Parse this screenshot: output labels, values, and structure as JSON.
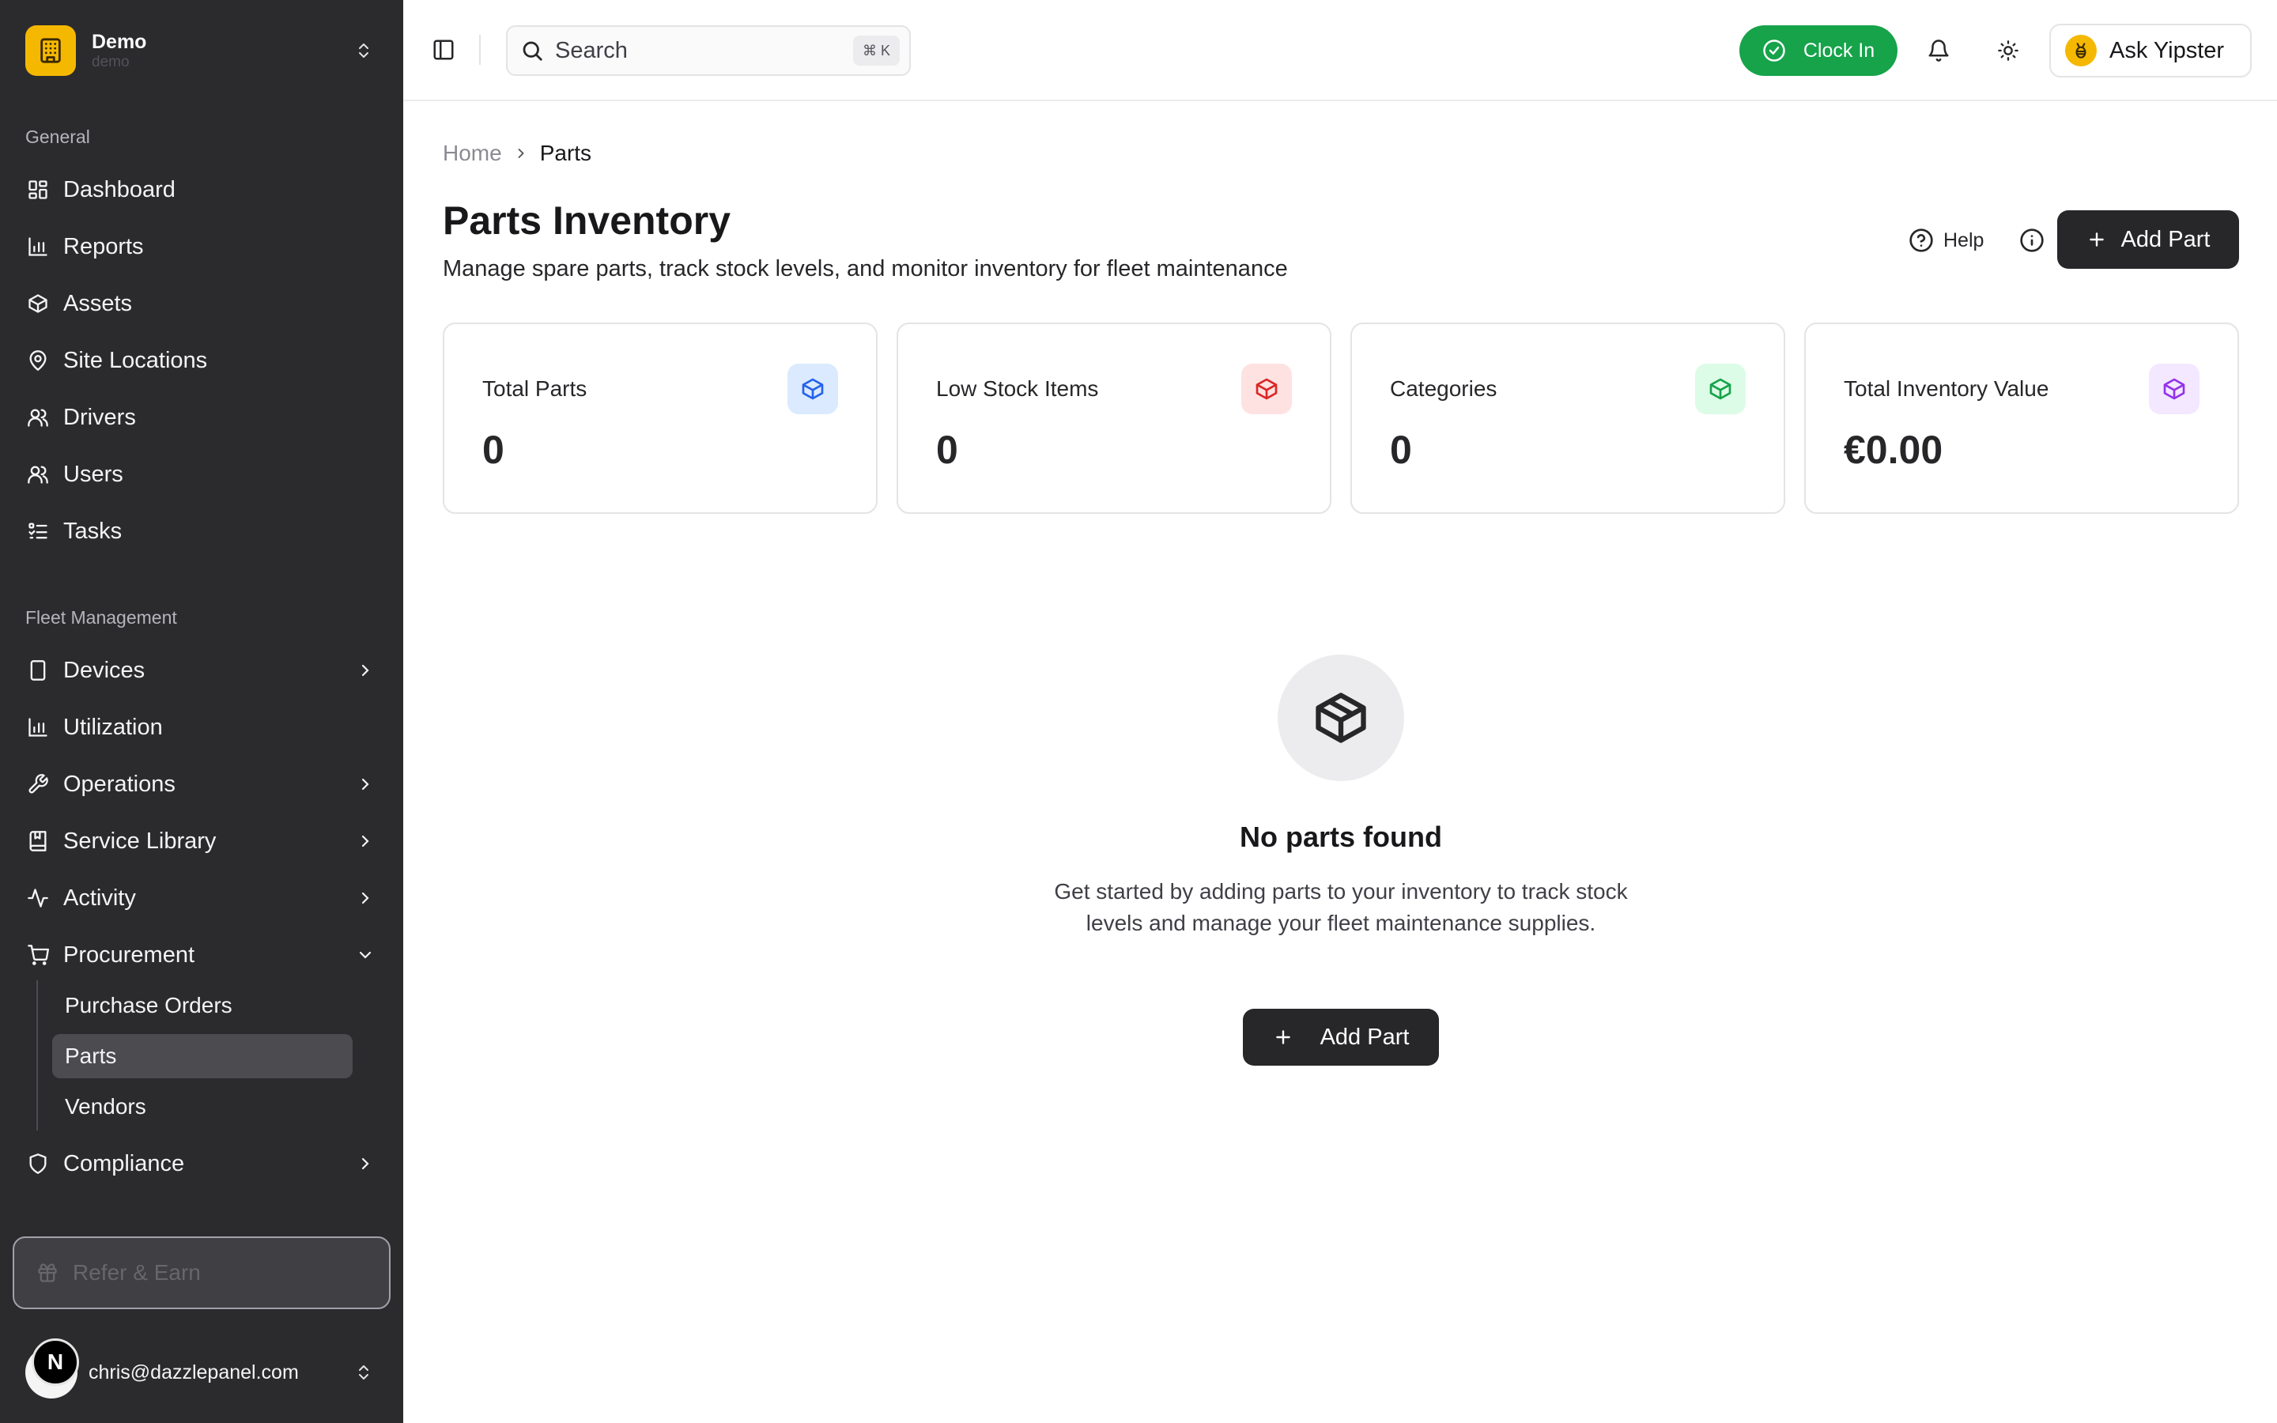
{
  "workspace": {
    "name": "Demo",
    "subtitle": "demo"
  },
  "sidebar": {
    "general_label": "General",
    "general_items": [
      {
        "label": "Dashboard",
        "icon": "dashboard-icon"
      },
      {
        "label": "Reports",
        "icon": "bar-chart-icon"
      },
      {
        "label": "Assets",
        "icon": "box-icon"
      },
      {
        "label": "Site Locations",
        "icon": "map-pin-icon"
      },
      {
        "label": "Drivers",
        "icon": "users-icon"
      },
      {
        "label": "Users",
        "icon": "users-icon"
      },
      {
        "label": "Tasks",
        "icon": "list-checks-icon"
      }
    ],
    "fleet_label": "Fleet Management",
    "fleet_items": [
      {
        "label": "Devices",
        "icon": "tablet-icon",
        "has_children": true,
        "expanded": false
      },
      {
        "label": "Utilization",
        "icon": "bar-chart-icon",
        "has_children": false
      },
      {
        "label": "Operations",
        "icon": "wrench-icon",
        "has_children": true,
        "expanded": false
      },
      {
        "label": "Service Library",
        "icon": "book-icon",
        "has_children": true,
        "expanded": false
      },
      {
        "label": "Activity",
        "icon": "activity-icon",
        "has_children": true,
        "expanded": false
      },
      {
        "label": "Procurement",
        "icon": "cart-icon",
        "has_children": true,
        "expanded": true
      },
      {
        "label": "Compliance",
        "icon": "shield-icon",
        "has_children": true,
        "expanded": false
      }
    ],
    "procurement_children": [
      {
        "label": "Purchase Orders",
        "active": false
      },
      {
        "label": "Parts",
        "active": true
      },
      {
        "label": "Vendors",
        "active": false
      }
    ],
    "refer_label": "Refer & Earn",
    "user": {
      "avatar_letter": "N",
      "email": "chris@dazzlepanel.com"
    }
  },
  "header": {
    "search_placeholder": "Search",
    "search_shortcut": "⌘ K",
    "clock_in_label": "Clock In",
    "ask_label": "Ask Yipster"
  },
  "breadcrumb": {
    "home": "Home",
    "current": "Parts"
  },
  "page": {
    "title": "Parts Inventory",
    "subtitle": "Manage spare parts, track stock levels, and monitor inventory for fleet maintenance",
    "help_label": "Help",
    "add_part_label": "Add Part"
  },
  "stats": [
    {
      "label": "Total Parts",
      "value": "0",
      "icon": "box-icon",
      "color": "#2563eb",
      "bg": "#dbeafe"
    },
    {
      "label": "Low Stock Items",
      "value": "0",
      "icon": "box-icon",
      "color": "#dc2626",
      "bg": "#fee2e2"
    },
    {
      "label": "Categories",
      "value": "0",
      "icon": "box-icon",
      "color": "#16a34a",
      "bg": "#dcfce7"
    },
    {
      "label": "Total Inventory Value",
      "value": "€0.00",
      "icon": "box-icon",
      "color": "#9333ea",
      "bg": "#f3e8ff"
    }
  ],
  "empty_state": {
    "icon": "package-icon",
    "title": "No parts found",
    "description": "Get started by adding parts to your inventory to track stock levels and manage your fleet maintenance supplies.",
    "button_label": "Add Part"
  },
  "colors": {
    "sidebar_bg": "#2b2b2e",
    "accent": "#27272a",
    "clock_in": "#16a34a",
    "brand": "#f5b800"
  }
}
